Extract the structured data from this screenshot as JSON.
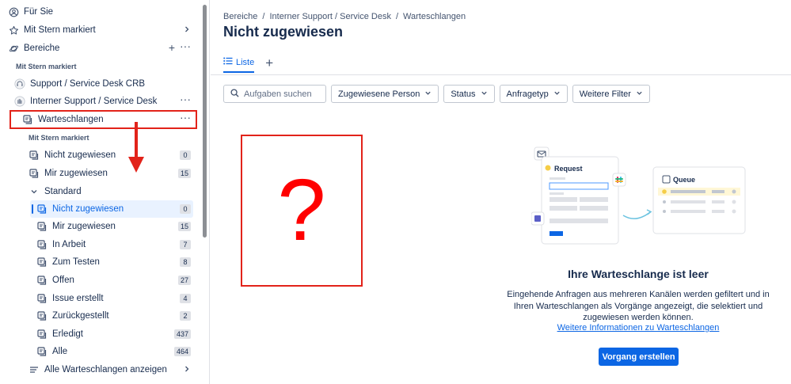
{
  "sidebar": {
    "for_you": "Für Sie",
    "starred": "Mit Stern markiert",
    "areas": "Bereiche",
    "section_starred": "Mit Stern markiert",
    "project1": "Support / Service Desk CRB",
    "project2": "Interner Support / Service Desk",
    "queues": "Warteschlangen",
    "section_starred2": "Mit Stern markiert",
    "starred_queues": [
      {
        "label": "Nicht zugewiesen",
        "count": "0"
      },
      {
        "label": "Mir zugewiesen",
        "count": "15"
      }
    ],
    "standard": "Standard",
    "standard_queues": [
      {
        "label": "Nicht zugewiesen",
        "count": "0"
      },
      {
        "label": "Mir zugewiesen",
        "count": "15"
      },
      {
        "label": "In Arbeit",
        "count": "7"
      },
      {
        "label": "Zum Testen",
        "count": "8"
      },
      {
        "label": "Offen",
        "count": "27"
      },
      {
        "label": "Issue erstellt",
        "count": "4"
      },
      {
        "label": "Zurückgestellt",
        "count": "2"
      },
      {
        "label": "Erledigt",
        "count": "437"
      },
      {
        "label": "Alle",
        "count": "464"
      }
    ],
    "all_queues": "Alle Warteschlangen anzeigen"
  },
  "breadcrumbs": [
    "Bereiche",
    "/",
    "Interner Support / Service Desk",
    "/",
    "Warteschlangen"
  ],
  "page_title": "Nicht zugewiesen",
  "tab_list": "Liste",
  "filters": {
    "search_placeholder": "Aufgaben suchen",
    "assignee": "Zugewiesene Person",
    "status": "Status",
    "request_type": "Anfragetyp",
    "more": "Weitere Filter"
  },
  "placeholder_glyph": "?",
  "illustration": {
    "request": "Request",
    "queue": "Queue"
  },
  "empty_state": {
    "title": "Ihre Warteschlange ist leer",
    "description": "Eingehende Anfragen aus mehreren Kanälen werden gefiltert und in Ihren Warteschlangen als Vorgänge angezeigt, die selektiert und zugewiesen werden können.",
    "link": "Weitere Informationen zu Warteschlangen",
    "button": "Vorgang erstellen"
  },
  "colors": {
    "accent": "#0c66e4",
    "annotation": "#e2231a",
    "selected_bg": "#e9f2ff"
  }
}
